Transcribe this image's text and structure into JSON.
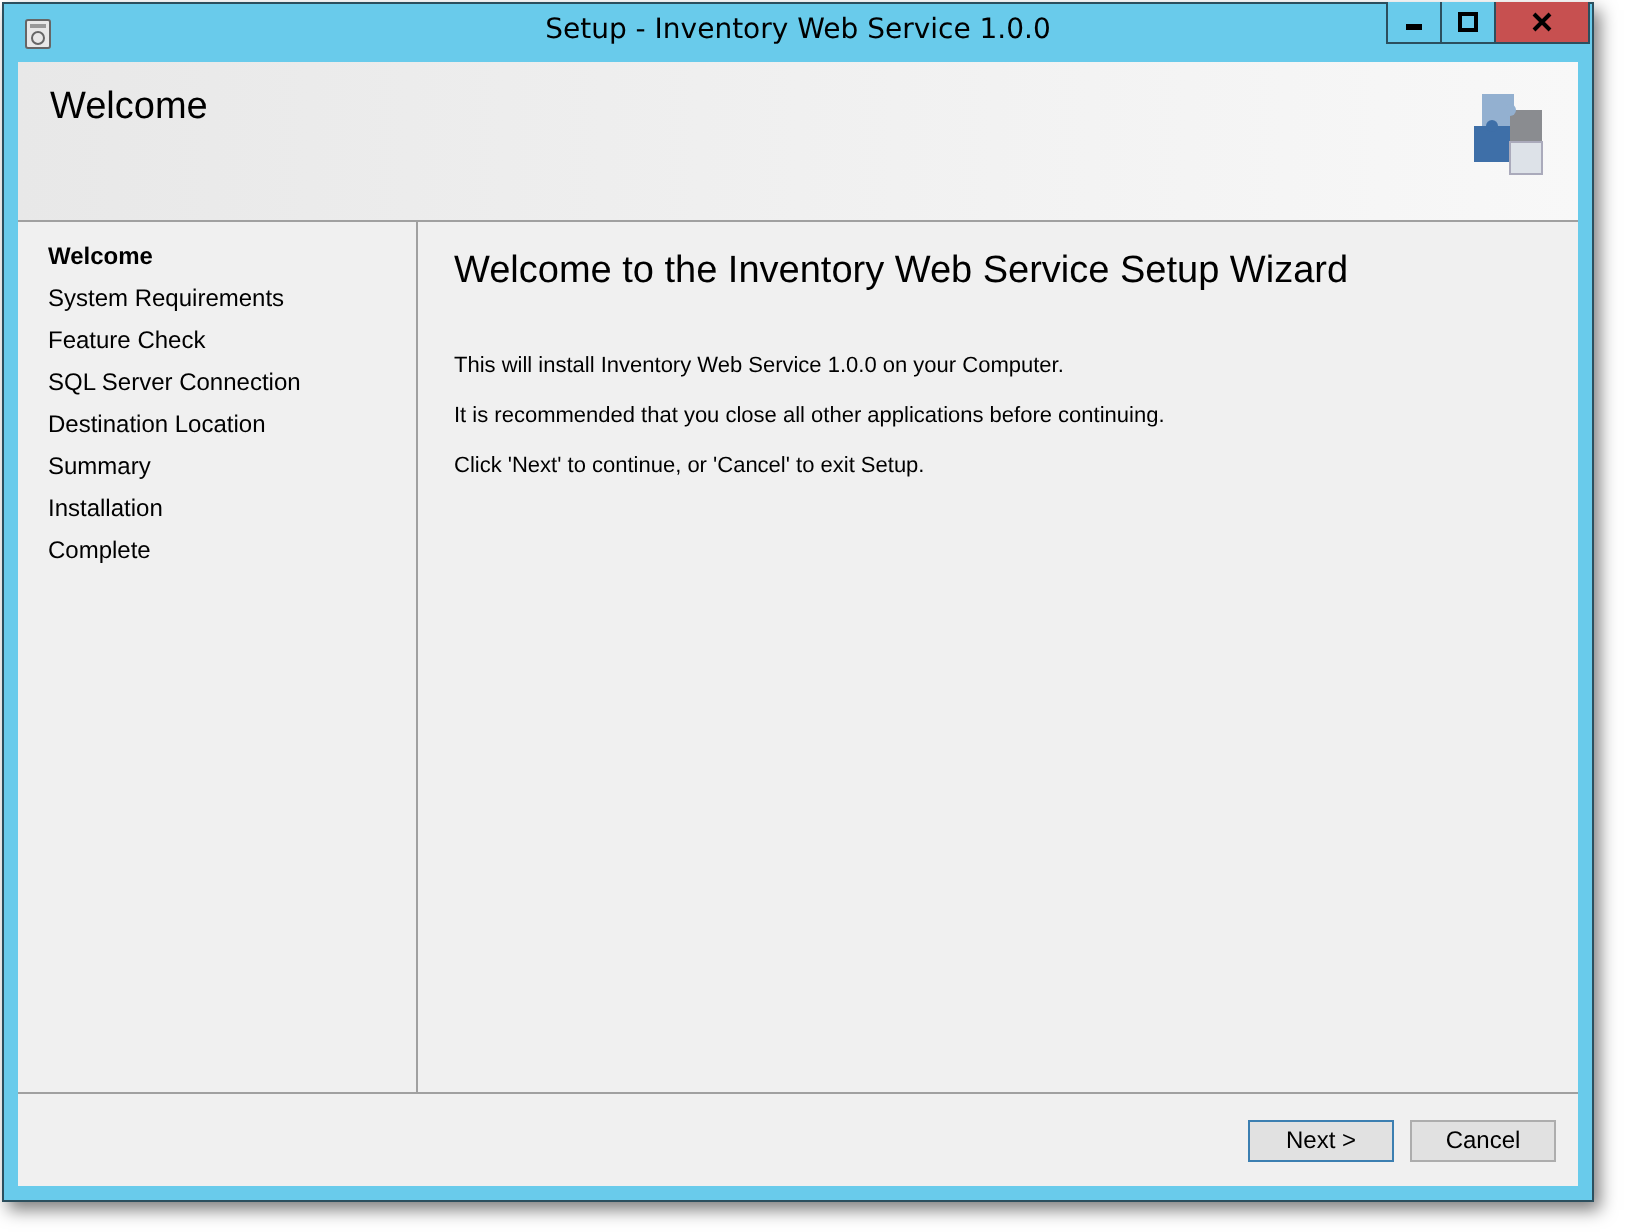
{
  "window": {
    "title": "Setup - Inventory Web Service 1.0.0"
  },
  "header": {
    "title": "Welcome"
  },
  "steps": [
    {
      "label": "Welcome",
      "selected": true
    },
    {
      "label": "System Requirements",
      "selected": false
    },
    {
      "label": "Feature Check",
      "selected": false
    },
    {
      "label": "SQL Server Connection",
      "selected": false
    },
    {
      "label": "Destination Location",
      "selected": false
    },
    {
      "label": "Summary",
      "selected": false
    },
    {
      "label": "Installation",
      "selected": false
    },
    {
      "label": "Complete",
      "selected": false
    }
  ],
  "content": {
    "heading": "Welcome to the Inventory Web Service Setup Wizard",
    "paragraphs": [
      "This will install Inventory Web Service 1.0.0 on your Computer.",
      "It is recommended that you close all other applications before continuing.",
      "Click 'Next' to continue, or 'Cancel' to exit Setup."
    ]
  },
  "buttons": [
    {
      "label": "Next >",
      "default": true
    },
    {
      "label": "Cancel",
      "default": false
    }
  ]
}
